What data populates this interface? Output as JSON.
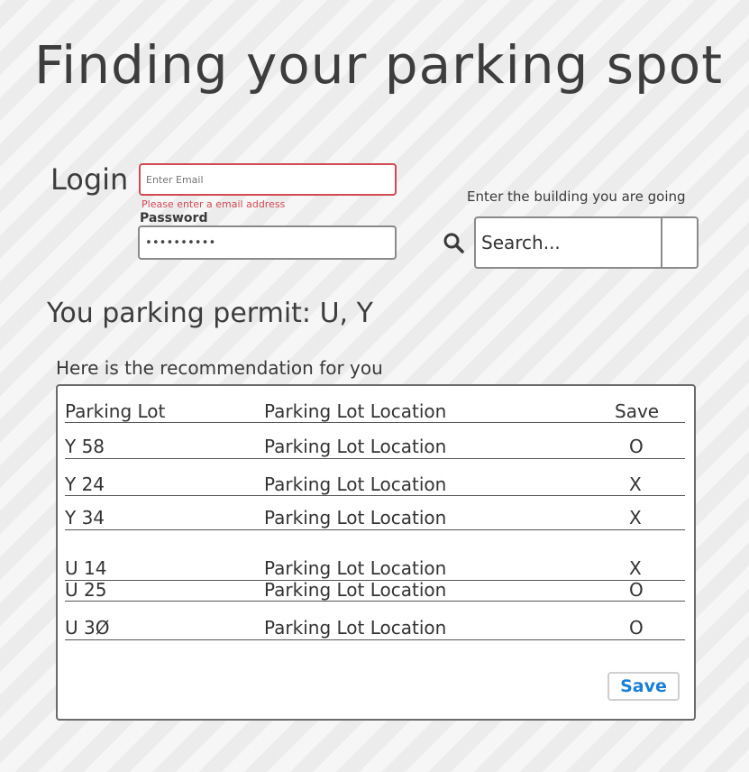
{
  "page": {
    "title": "Finding your parking spot"
  },
  "login": {
    "label": "Login",
    "email_placeholder": "Enter Email",
    "email_error": "Please enter a email address",
    "password_label": "Password",
    "password_value": "••••••••••"
  },
  "search": {
    "prompt": "Enter the building you are going",
    "placeholder": "Search...",
    "icon": "search-icon"
  },
  "permit": {
    "text": "You parking permit: U, Y"
  },
  "recommendation": {
    "heading": "Here is the recommendation for you",
    "columns": [
      "Parking Lot",
      "Parking Lot Location",
      "Save"
    ],
    "rows": [
      {
        "lot": "Y 58",
        "location": "Parking Lot Location",
        "save": "O"
      },
      {
        "lot": "Y 24",
        "location": "Parking Lot Location",
        "save": "X"
      },
      {
        "lot": "Y 34",
        "location": "Parking Lot Location",
        "save": "X"
      },
      {
        "lot": "U 14",
        "location": "Parking Lot Location",
        "save": "X"
      },
      {
        "lot": "U 25",
        "location": "Parking Lot Location",
        "save": "O"
      },
      {
        "lot": "U 3Ø",
        "location": "Parking Lot Location",
        "save": "O"
      }
    ],
    "save_button": "Save"
  },
  "colors": {
    "error": "#d24a56",
    "accent": "#1a7fd6",
    "border": "#8a8a8a"
  }
}
